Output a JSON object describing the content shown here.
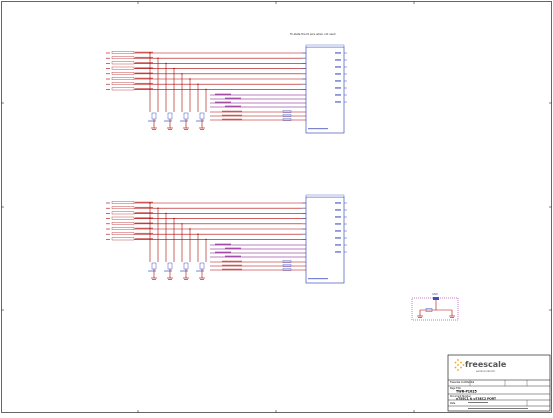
{
  "header_note": "Tri-state the IO pins when not used",
  "logo": {
    "name": "freescale",
    "tagline": "semiconductor"
  },
  "title_block": {
    "board_label": "TWR-P1025",
    "doc_title": "uTSEC1 & uTSEC2 PORT",
    "rows": [
      "Freescale Confidential",
      "Page Title",
      "Document Number",
      "Date"
    ]
  },
  "gnd_label": "GND",
  "colors": {
    "wire": "#b00000",
    "net": "#7a0080",
    "component": "#4050c0",
    "frame": "#000000"
  }
}
